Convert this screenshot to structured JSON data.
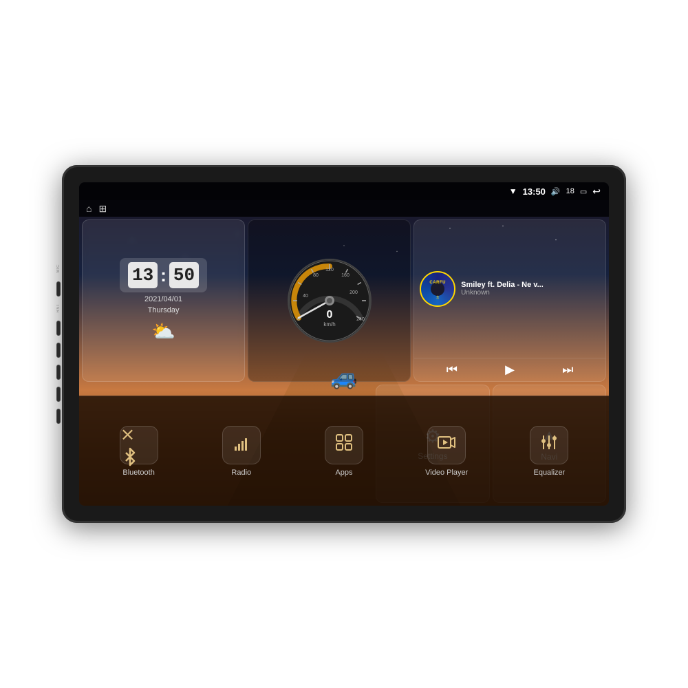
{
  "device": {
    "outer_bg": "#1a1a1a"
  },
  "status_bar": {
    "wifi": "▼",
    "time": "13:50",
    "volume_icon": "🔊",
    "volume_level": "18",
    "battery_icon": "🔋",
    "back_icon": "↩"
  },
  "top_nav": {
    "home_icon": "⌂",
    "app_icon": "⊞"
  },
  "clock": {
    "hour": "13",
    "minute": "50",
    "date": "2021/04/01",
    "day": "Thursday"
  },
  "speedometer": {
    "speed": "0",
    "unit": "km/h",
    "max": "240"
  },
  "music": {
    "title": "Smiley ft. Delia - Ne v...",
    "artist": "Unknown",
    "logo": "CARFU"
  },
  "action_buttons": {
    "settings_label": "Settings",
    "navi_label": "Navi"
  },
  "bottom_bar": {
    "items": [
      {
        "icon": "bluetooth",
        "label": "Bluetooth"
      },
      {
        "icon": "radio",
        "label": "Radio"
      },
      {
        "icon": "apps",
        "label": "Apps"
      },
      {
        "icon": "video",
        "label": "Video Player"
      },
      {
        "icon": "equalizer",
        "label": "Equalizer"
      }
    ]
  }
}
